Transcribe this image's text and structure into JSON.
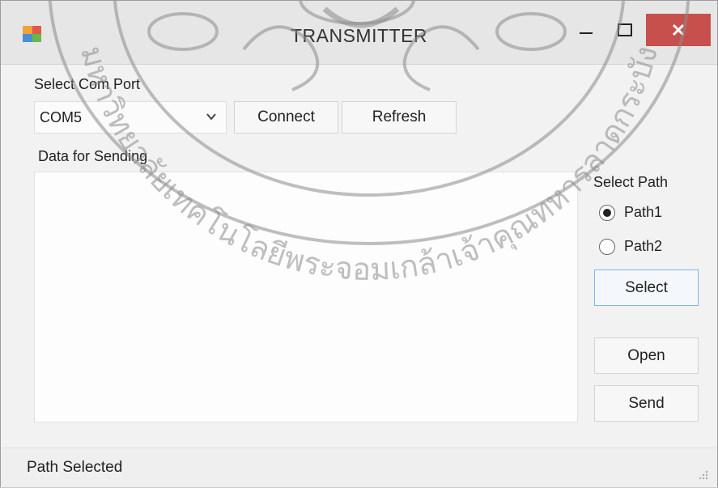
{
  "window": {
    "title": "TRANSMITTER",
    "minimize_icon": "minimize-icon",
    "maximize_icon": "maximize-icon",
    "close_icon": "close-icon",
    "close_color": "#c7504c"
  },
  "com_port": {
    "label": "Select Com Port",
    "selected": "COM5",
    "connect_label": "Connect",
    "refresh_label": "Refresh"
  },
  "data_section": {
    "label": "Data for Sending",
    "value": ""
  },
  "path_panel": {
    "label": "Select Path",
    "options": [
      {
        "label": "Path1",
        "checked": true
      },
      {
        "label": "Path2",
        "checked": false
      }
    ],
    "select_label": "Select",
    "open_label": "Open",
    "send_label": "Send"
  },
  "status": {
    "text": "Path Selected"
  },
  "watermark": {
    "text": "มหาวิทยาลัยเทคโนโลยีพระจอมเกล้าเจ้าคุณทหารลาดกระบัง"
  }
}
